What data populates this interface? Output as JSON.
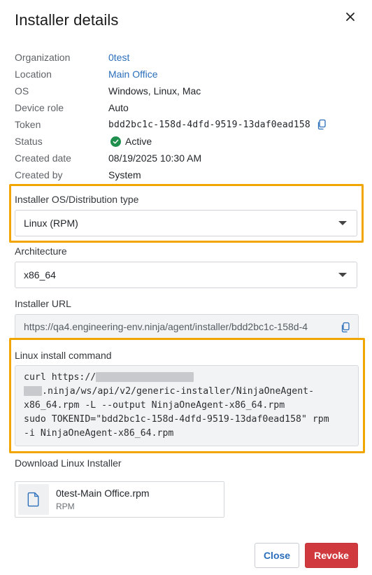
{
  "modal": {
    "title": "Installer details"
  },
  "details": [
    {
      "label": "Organization",
      "value": "0test"
    },
    {
      "label": "Location",
      "value": "Main Office"
    },
    {
      "label": "OS",
      "value": "Windows, Linux, Mac"
    },
    {
      "label": "Device role",
      "value": "Auto"
    },
    {
      "label": "Token",
      "value": "bdd2bc1c-158d-4dfd-9519-13daf0ead158"
    },
    {
      "label": "Status",
      "value": "Active"
    },
    {
      "label": "Created date",
      "value": "08/19/2025 10:30 AM"
    },
    {
      "label": "Created by",
      "value": "System"
    }
  ],
  "installer_os": {
    "label": "Installer OS/Distribution type",
    "value": "Linux (RPM)"
  },
  "architecture": {
    "label": "Architecture",
    "value": "x86_64"
  },
  "installer_url": {
    "label": "Installer URL",
    "value": "https://qa4.engineering-env.ninja/agent/installer/bdd2bc1c-158d-4"
  },
  "install_command": {
    "label": "Linux install command",
    "line1_prefix": "curl https://",
    "line2_suffix": ".ninja/ws/api/v2/generic-installer/NinjaOneAgent-",
    "line3": "x86_64.rpm -L --output NinjaOneAgent-x86_64.rpm",
    "line4": "sudo TOKENID=\"bdd2bc1c-158d-4dfd-9519-13daf0ead158\" rpm",
    "line5": "-i NinjaOneAgent-x86_64.rpm"
  },
  "download": {
    "label": "Download Linux Installer",
    "file_name": "0test-Main Office.rpm",
    "file_type": "RPM"
  },
  "buttons": {
    "close": "Close",
    "revoke": "Revoke"
  },
  "icons": {
    "close": "close-icon",
    "copy": "copy-icon",
    "status": "check-circle-icon",
    "file": "file-icon",
    "dropdown": "caret-down-icon"
  },
  "colors": {
    "link": "#2a6ebb",
    "status_active": "#1f8f4e",
    "highlight": "#f0a500",
    "revoke": "#d03a3f"
  }
}
